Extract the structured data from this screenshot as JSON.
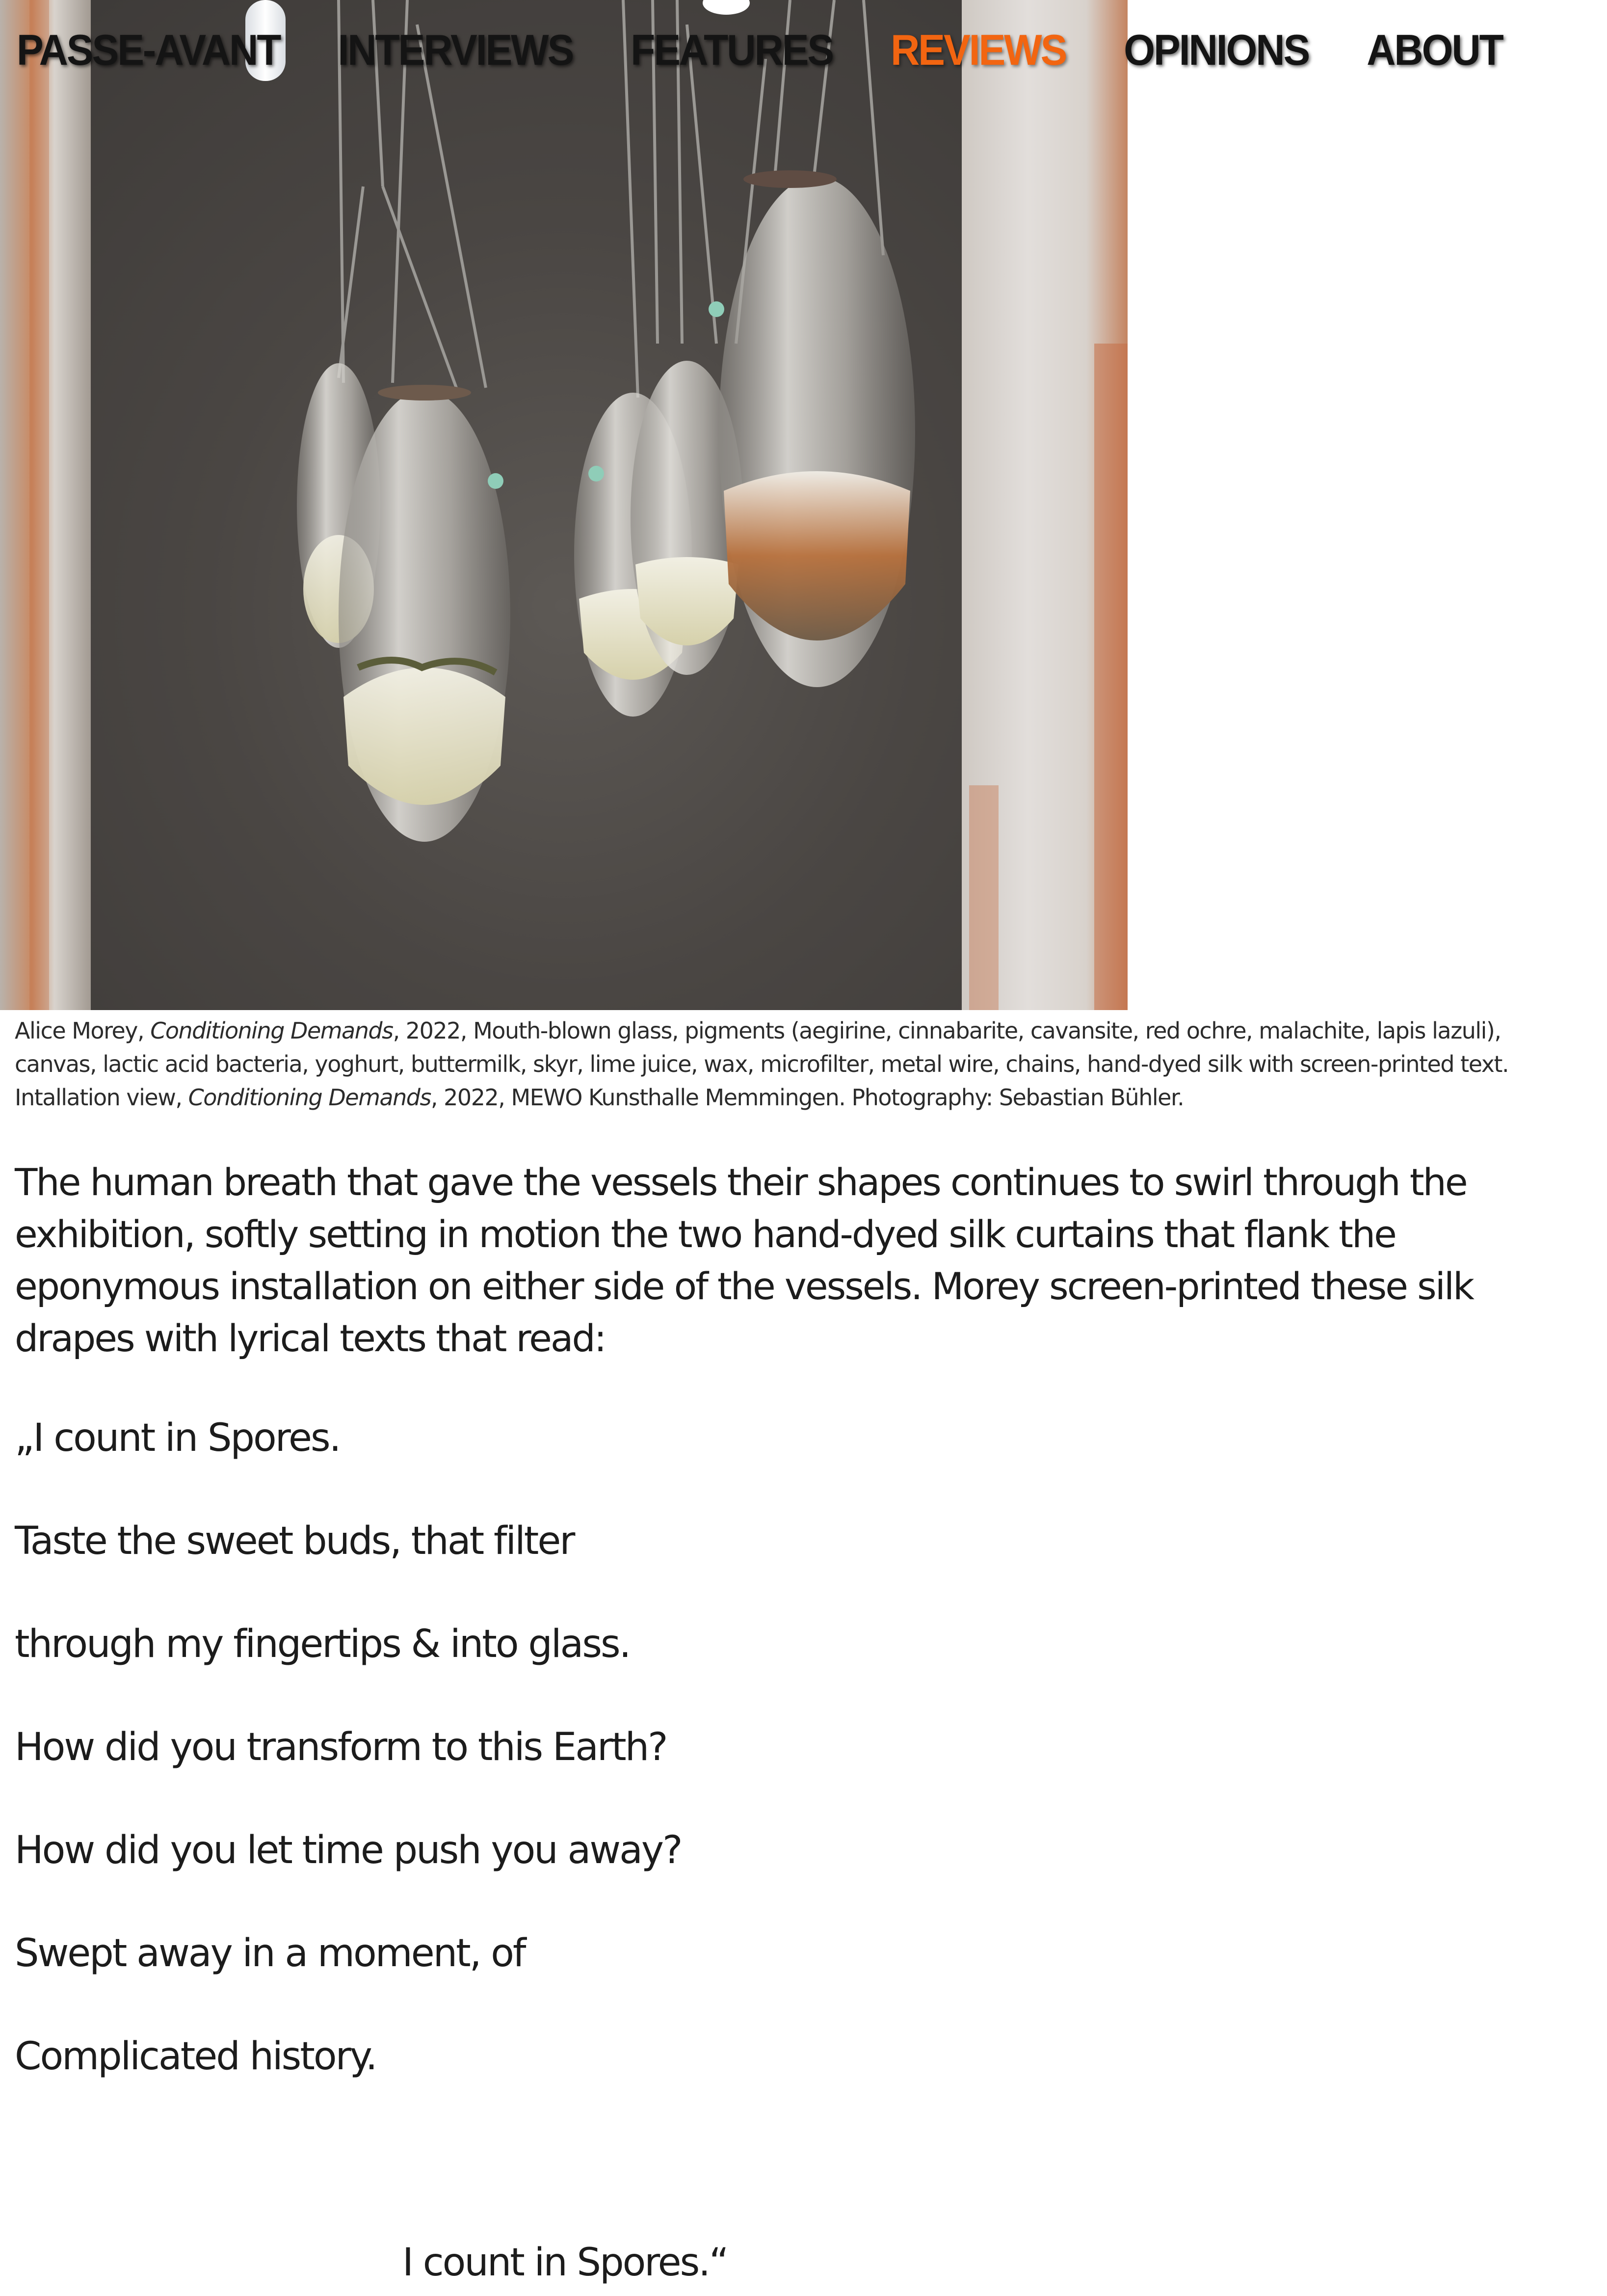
{
  "nav": {
    "items": [
      {
        "label": "PASSE-AVANT",
        "active": false
      },
      {
        "label": "INTERVIEWS",
        "active": false
      },
      {
        "label": "FEATURES",
        "active": false
      },
      {
        "label": "REVIEWS",
        "active": true
      },
      {
        "label": "OPINIONS",
        "active": false
      },
      {
        "label": "ABOUT",
        "active": false
      }
    ],
    "active_color": "#f26511"
  },
  "hero": {
    "image_subject": "hanging-glass-vessels-installation"
  },
  "caption": {
    "part1": "Alice Morey, ",
    "title1": "Conditioning Demands",
    "part2": ", 2022, Mouth-blown glass, pigments (aegirine, cinnabarite, cavansite, red ochre, malachite, lapis lazuli), canvas, lactic acid bacteria, yoghurt, buttermilk, skyr, lime juice, wax, microfilter, metal wire, chains, hand-dyed silk with screen-printed text. Intallation view, ",
    "title2": "Conditioning Demands",
    "part3": ", 2022, MEWO Kunsthalle Memmingen. Photography: Sebastian Bühler."
  },
  "body": {
    "paragraph": "The human breath that gave the vessels their shapes continues to swirl through the exhibition, softly setting in motion the two hand-dyed silk curtains that flank the eponymous installation on either side of the vessels. Morey screen-printed these silk drapes with lyrical texts that read:"
  },
  "poem": {
    "lines": [
      "„I count in Spores.",
      "Taste the sweet buds, that filter",
      "through my fingertips & into glass.",
      "How did you transform to this Earth?",
      "How did you let time push you away?",
      "Swept away in a moment, of",
      "Complicated history."
    ],
    "closing": "I count in Spores.“"
  }
}
